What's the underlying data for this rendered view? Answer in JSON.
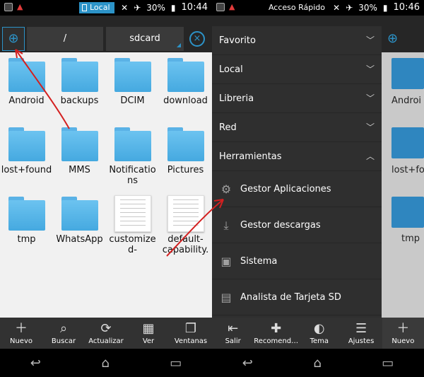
{
  "status_left": {
    "time": "10:44",
    "battery": "30%",
    "chip": "Local"
  },
  "status_right": {
    "time": "10:46",
    "battery": "30%",
    "title": "Acceso Rápido"
  },
  "toolbar": {
    "crumb_root": "/",
    "crumb_current": "sdcard",
    "close_symbol": "×"
  },
  "files": [
    {
      "name": "Android",
      "type": "folder"
    },
    {
      "name": "backups",
      "type": "folder"
    },
    {
      "name": "DCIM",
      "type": "folder"
    },
    {
      "name": "download",
      "type": "folder"
    },
    {
      "name": "lost+found",
      "type": "folder"
    },
    {
      "name": "MMS",
      "type": "folder"
    },
    {
      "name": "Notificatio\nns",
      "type": "folder"
    },
    {
      "name": "Pictures",
      "type": "folder"
    },
    {
      "name": "tmp",
      "type": "folder"
    },
    {
      "name": "WhatsApp",
      "type": "folder"
    },
    {
      "name": "customize\nd-",
      "type": "file"
    },
    {
      "name": "default-\ncapability.",
      "type": "file"
    }
  ],
  "bottom_left": [
    {
      "label": "Nuevo",
      "icon": "plus-icon"
    },
    {
      "label": "Buscar",
      "icon": "search-icon"
    },
    {
      "label": "Actualizar",
      "icon": "refresh-icon"
    },
    {
      "label": "Ver",
      "icon": "grid-icon"
    },
    {
      "label": "Ventanas",
      "icon": "windows-icon"
    }
  ],
  "drawer": {
    "sections": [
      "Favorito",
      "Local",
      "Libreria",
      "Red",
      "Herramientas"
    ],
    "tools": [
      {
        "label": "Gestor Aplicaciones",
        "icon": "gears-icon"
      },
      {
        "label": "Gestor descargas",
        "icon": "download-icon"
      },
      {
        "label": "Sistema",
        "icon": "system-icon"
      },
      {
        "label": "Analista de Tarjeta SD",
        "icon": "sdcard-icon"
      }
    ]
  },
  "strip_labels": [
    "Androi",
    "lost+fou",
    "tmp"
  ],
  "bottom_right": [
    {
      "label": "Salir",
      "icon": "exit-icon"
    },
    {
      "label": "Recomend…",
      "icon": "gift-icon"
    },
    {
      "label": "Tema",
      "icon": "theme-icon"
    },
    {
      "label": "Ajustes",
      "icon": "settings-icon"
    },
    {
      "label": "Nuevo",
      "icon": "plus-icon"
    }
  ],
  "colors": {
    "accent": "#2c93c8",
    "folder": "#5ab2e6",
    "toolbar": "#262626",
    "drawer": "#2f2f2f",
    "arrow": "#d42020"
  }
}
